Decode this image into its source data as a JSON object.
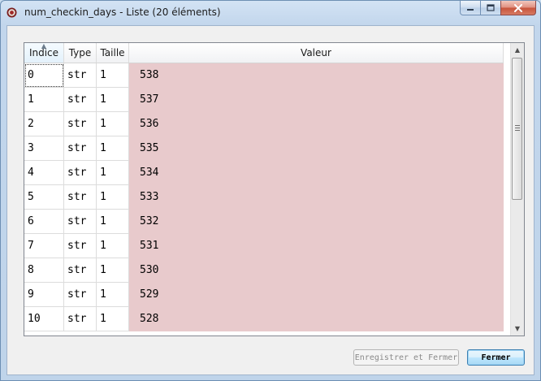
{
  "window": {
    "title": "num_checkin_days - Liste (20 éléments)",
    "icon": "spyder-bug-icon"
  },
  "caption": {
    "minimize": "minimize-icon",
    "maximize": "maximize-icon",
    "close": "close-icon"
  },
  "table": {
    "columns": [
      "Indice",
      "Type",
      "Taille",
      "Valeur"
    ],
    "rows": [
      {
        "index": "0",
        "type": "str",
        "size": "1",
        "value": "538"
      },
      {
        "index": "1",
        "type": "str",
        "size": "1",
        "value": "537"
      },
      {
        "index": "2",
        "type": "str",
        "size": "1",
        "value": "536"
      },
      {
        "index": "3",
        "type": "str",
        "size": "1",
        "value": "535"
      },
      {
        "index": "4",
        "type": "str",
        "size": "1",
        "value": "534"
      },
      {
        "index": "5",
        "type": "str",
        "size": "1",
        "value": "533"
      },
      {
        "index": "6",
        "type": "str",
        "size": "1",
        "value": "532"
      },
      {
        "index": "7",
        "type": "str",
        "size": "1",
        "value": "531"
      },
      {
        "index": "8",
        "type": "str",
        "size": "1",
        "value": "530"
      },
      {
        "index": "9",
        "type": "str",
        "size": "1",
        "value": "529"
      },
      {
        "index": "10",
        "type": "str",
        "size": "1",
        "value": "528"
      }
    ],
    "value_cell_color": "#e8cacc",
    "sorted_column": "Indice"
  },
  "buttons": {
    "save_close": "Enregistrer et Fermer",
    "close": "Fermer"
  }
}
